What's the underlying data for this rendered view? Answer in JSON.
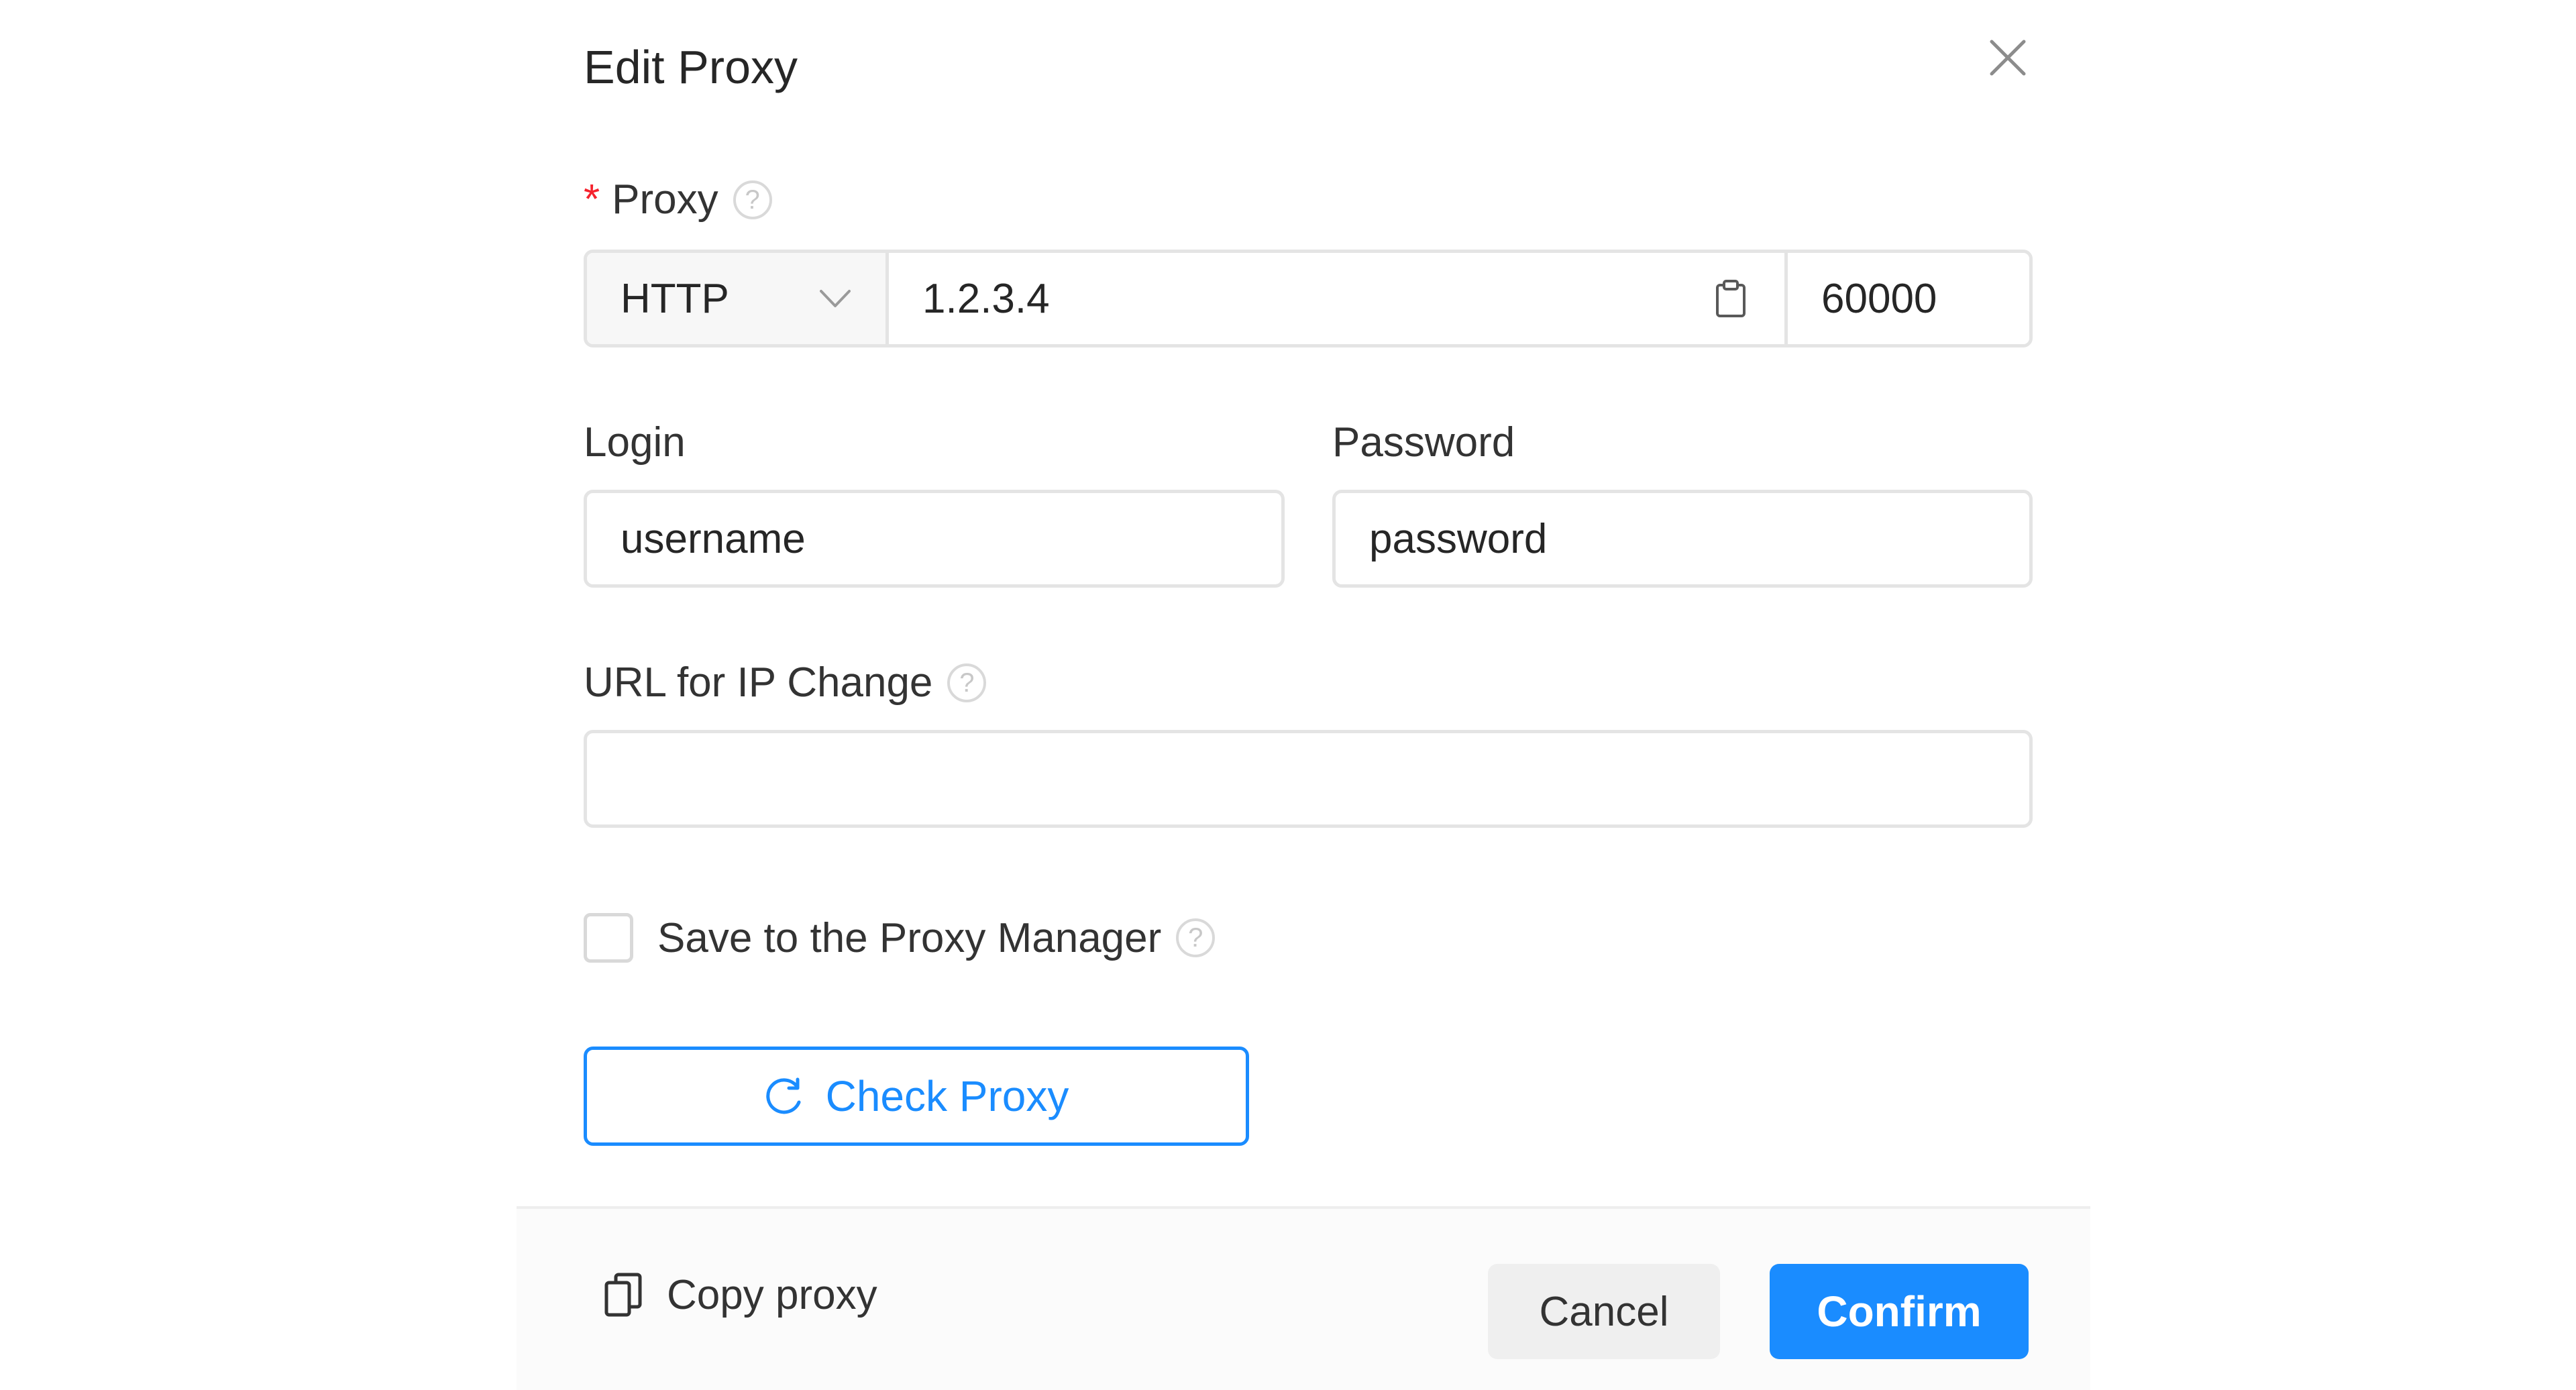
{
  "dialog": {
    "title": "Edit Proxy"
  },
  "proxy": {
    "required_mark": "*",
    "label": "Proxy",
    "type": "HTTP",
    "host": "1.2.3.4",
    "port": "60000"
  },
  "login": {
    "label": "Login",
    "value": "username"
  },
  "password": {
    "label": "Password",
    "value": "password"
  },
  "ip_change": {
    "label": "URL for IP Change",
    "value": ""
  },
  "save_manager": {
    "label": "Save to the Proxy Manager",
    "checked": false
  },
  "actions": {
    "check_proxy": "Check Proxy",
    "copy_proxy": "Copy proxy",
    "cancel": "Cancel",
    "confirm": "Confirm"
  },
  "help_glyph": "?",
  "icons": {
    "close": "close-icon",
    "help": "help-circle-icon",
    "chevron": "chevron-down-icon",
    "paste": "clipboard-icon",
    "refresh": "refresh-icon",
    "copy": "copy-icon"
  },
  "colors": {
    "primary": "#1a8cff",
    "required": "#f5222d",
    "border": "#e4e4e4",
    "cancel_bg": "#efefef"
  }
}
